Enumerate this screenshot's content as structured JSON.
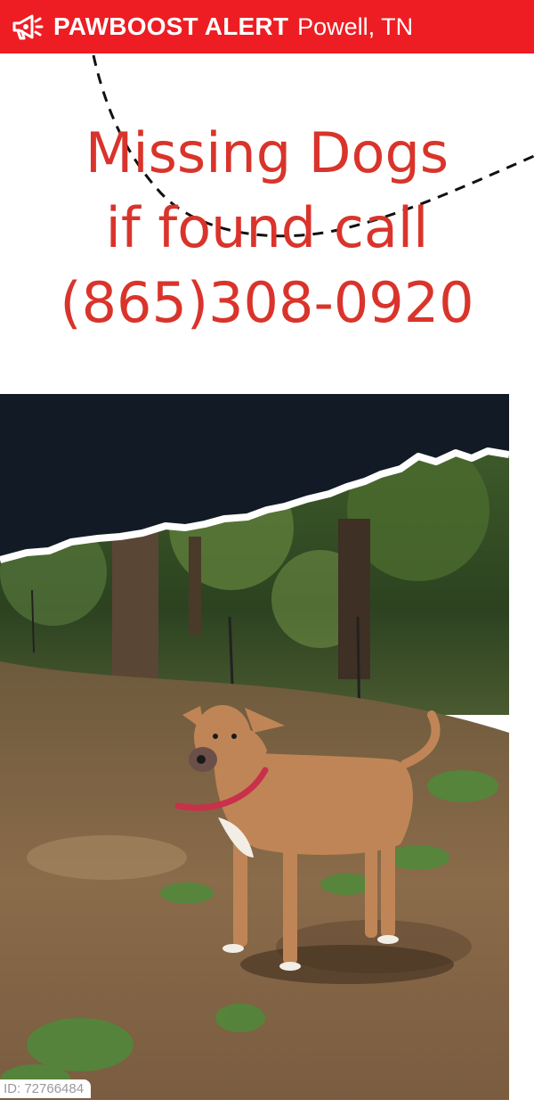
{
  "banner": {
    "brand": "PAWBOOST ALERT",
    "location": "Powell, TN",
    "logo_icon": "megaphone-paw-icon",
    "bg_color": "#ee1d23"
  },
  "flyer": {
    "line1": "Missing Dogs",
    "line2": "if found call",
    "line3": "(865)308-0920",
    "text_color": "#d9342b"
  },
  "photo": {
    "subject": "dog-photo",
    "id_label": "ID: 72766484"
  }
}
